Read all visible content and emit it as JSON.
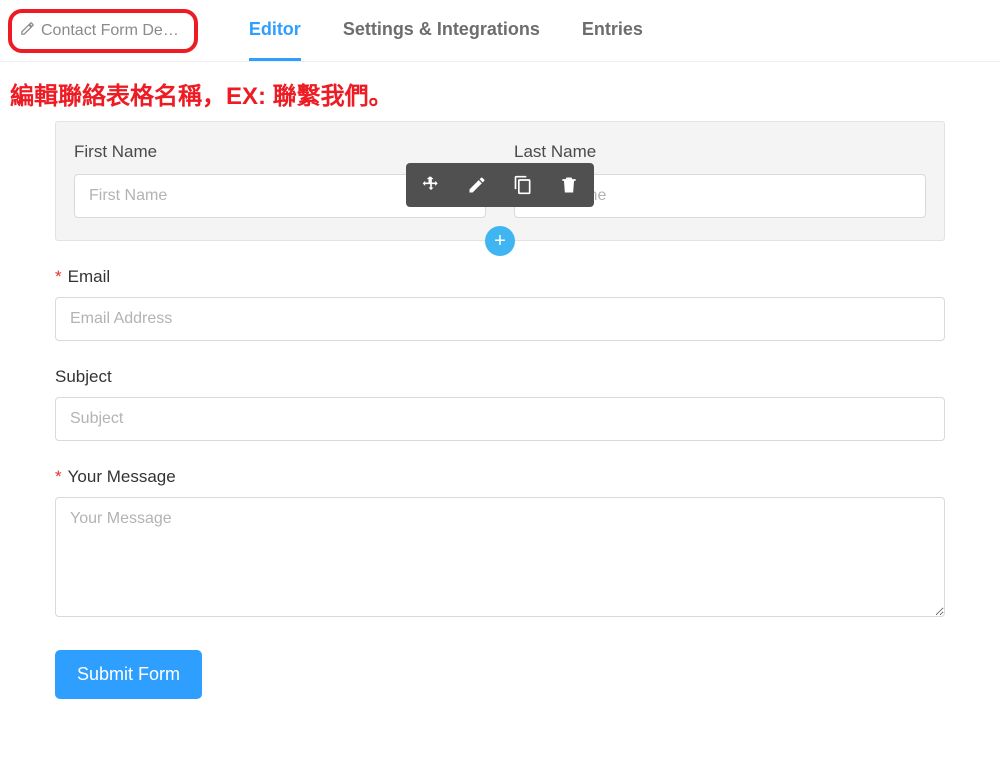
{
  "header": {
    "form_title_truncated": "Contact Form De…",
    "tabs": {
      "editor": "Editor",
      "settings": "Settings & Integrations",
      "entries": "Entries"
    }
  },
  "annotation": "編輯聯絡表格名稱，EX: 聯繫我們。",
  "fields": {
    "first_name": {
      "label": "First Name",
      "placeholder": "First Name"
    },
    "last_name": {
      "label": "Last Name",
      "placeholder": "Last Name"
    },
    "email": {
      "label": "Email",
      "placeholder": "Email Address",
      "required_mark": "*"
    },
    "subject": {
      "label": "Subject",
      "placeholder": "Subject"
    },
    "message": {
      "label": "Your Message",
      "placeholder": "Your Message",
      "required_mark": "*"
    }
  },
  "buttons": {
    "submit": "Submit Form",
    "add": "+"
  }
}
